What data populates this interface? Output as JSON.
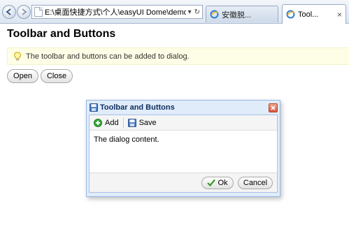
{
  "browser": {
    "address": "E:\\桌面快捷方式\\个人\\easyUI Dome\\demo\\dialog\\",
    "tabs": [
      {
        "label": "安徽脱..."
      },
      {
        "label": "Tool..."
      }
    ],
    "tab_close_glyph": "×",
    "refresh_glyph": "↻",
    "dropdown_glyph": "▾"
  },
  "page": {
    "title": "Toolbar and Buttons",
    "tip": "The toolbar and buttons can be added to dialog.",
    "buttons": {
      "open": "Open",
      "close": "Close"
    }
  },
  "dialog": {
    "title": "Toolbar and Buttons",
    "toolbar": {
      "add": "Add",
      "save": "Save"
    },
    "content": "The dialog content.",
    "footer": {
      "ok": "Ok",
      "cancel": "Cancel"
    }
  },
  "colors": {
    "dialog_border": "#95b8e7",
    "dialog_header_bg": "#e0ecfa",
    "tip_bg": "#fefee6",
    "title_text": "#0e2d5f"
  }
}
